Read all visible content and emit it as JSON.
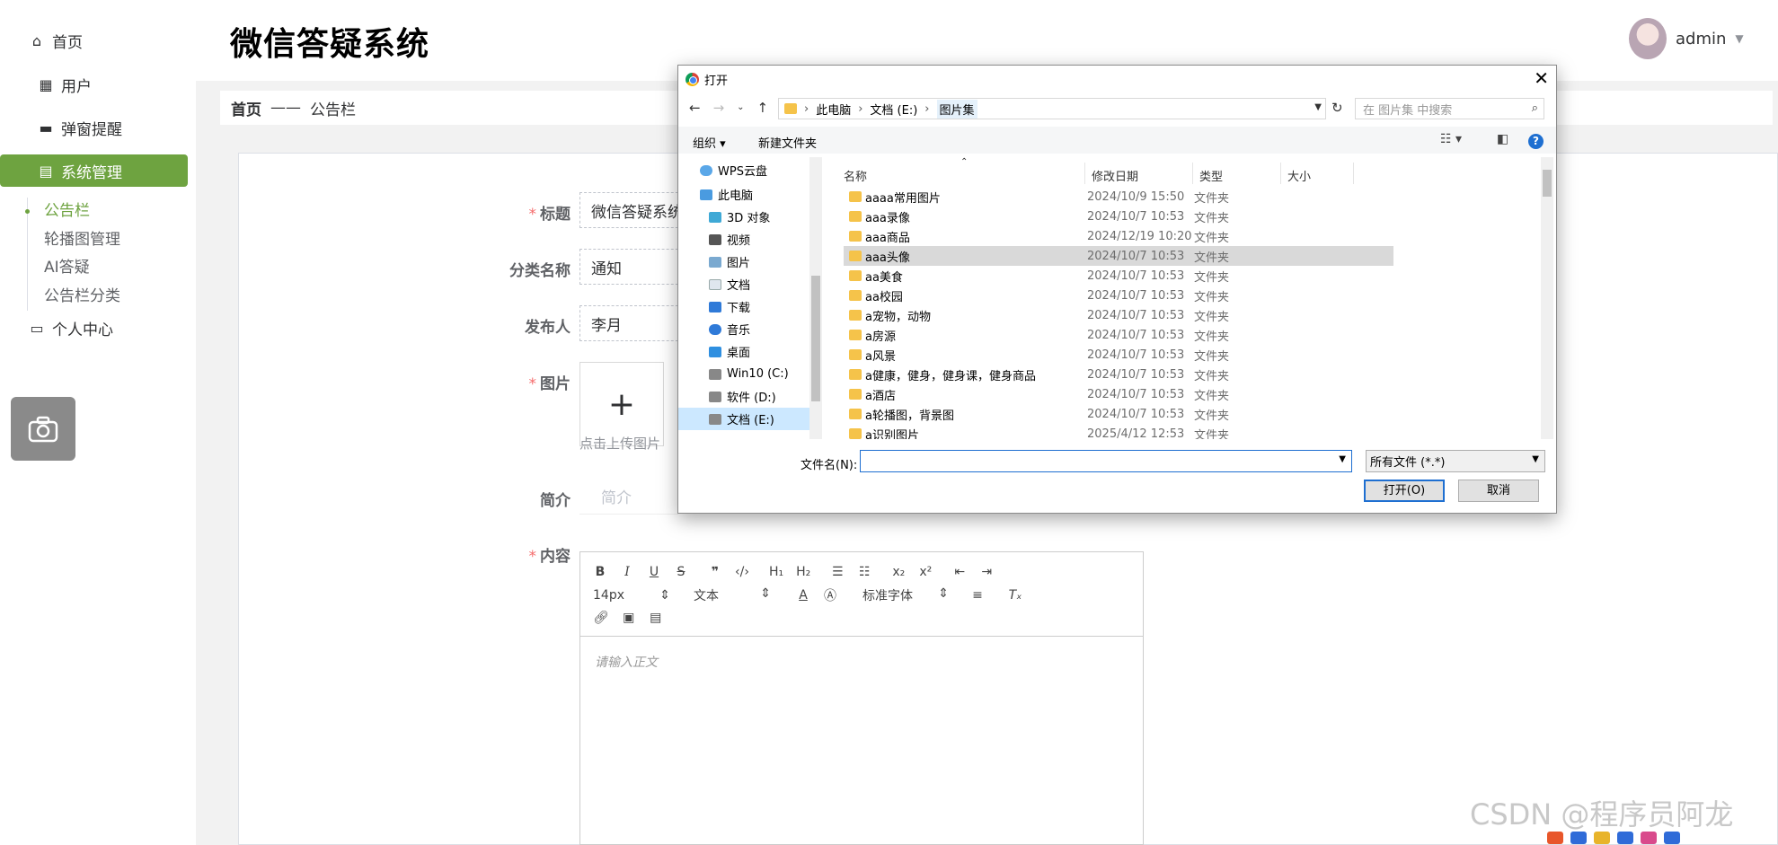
{
  "app": {
    "title": "微信答疑系统",
    "user": "admin"
  },
  "sidebar": {
    "items": [
      {
        "label": "首页",
        "icon": "home-icon"
      },
      {
        "label": "用户",
        "icon": "grid-icon"
      },
      {
        "label": "弹窗提醒",
        "icon": "monitor-icon"
      },
      {
        "label": "系统管理",
        "icon": "chart-icon"
      },
      {
        "label": "个人中心",
        "icon": "calendar-icon"
      }
    ],
    "sub_items": [
      "公告栏",
      "轮播图管理",
      "AI答疑",
      "公告栏分类"
    ]
  },
  "breadcrumb": {
    "home": "首页",
    "sep": "——",
    "current": "公告栏"
  },
  "form": {
    "title_label": "标题",
    "title_value": "微信答疑系统",
    "category_label": "分类名称",
    "category_value": "通知",
    "publisher_label": "发布人",
    "publisher_value": "李月",
    "image_label": "图片",
    "upload_hint": "点击上传图片",
    "intro_label": "简介",
    "intro_placeholder": "简介",
    "content_label": "内容"
  },
  "editor": {
    "font_size": "14px",
    "block_type": "文本",
    "font_family": "标准字体",
    "placeholder": "请输入正文"
  },
  "dialog": {
    "title": "打开",
    "path": [
      "此电脑",
      "文档 (E:)",
      "图片集"
    ],
    "search_placeholder": "在 图片集 中搜索",
    "organize": "组织 ▾",
    "new_folder": "新建文件夹",
    "columns": [
      "名称",
      "修改日期",
      "类型",
      "大小"
    ],
    "tree": [
      "WPS云盘",
      "此电脑",
      "3D 对象",
      "视频",
      "图片",
      "文档",
      "下载",
      "音乐",
      "桌面",
      "Win10 (C:)",
      "软件 (D:)",
      "文档 (E:)"
    ],
    "files": [
      {
        "name": "aaaa常用图片",
        "date": "2024/10/9 15:50",
        "type": "文件夹"
      },
      {
        "name": "aaa录像",
        "date": "2024/10/7 10:53",
        "type": "文件夹"
      },
      {
        "name": "aaa商品",
        "date": "2024/12/19 10:20",
        "type": "文件夹"
      },
      {
        "name": "aaa头像",
        "date": "2024/10/7 10:53",
        "type": "文件夹"
      },
      {
        "name": "aa美食",
        "date": "2024/10/7 10:53",
        "type": "文件夹"
      },
      {
        "name": "aa校园",
        "date": "2024/10/7 10:53",
        "type": "文件夹"
      },
      {
        "name": "a宠物，动物",
        "date": "2024/10/7 10:53",
        "type": "文件夹"
      },
      {
        "name": "a房源",
        "date": "2024/10/7 10:53",
        "type": "文件夹"
      },
      {
        "name": "a风景",
        "date": "2024/10/7 10:53",
        "type": "文件夹"
      },
      {
        "name": "a健康，健身，健身课，健身商品",
        "date": "2024/10/7 10:53",
        "type": "文件夹"
      },
      {
        "name": "a酒店",
        "date": "2024/10/7 10:53",
        "type": "文件夹"
      },
      {
        "name": "a轮播图，背景图",
        "date": "2024/10/7 10:53",
        "type": "文件夹"
      },
      {
        "name": "a识别图片",
        "date": "2025/4/12 12:53",
        "type": "文件夹"
      }
    ],
    "filename_label": "文件名(N):",
    "filetype": "所有文件 (*.*)",
    "open_btn": "打开(O)",
    "cancel_btn": "取消"
  },
  "watermark": "CSDN @程序员阿龙",
  "colors": {
    "accent": "#6ea340",
    "required": "#f56c6c",
    "dialog_focus": "#1e6fd1"
  }
}
